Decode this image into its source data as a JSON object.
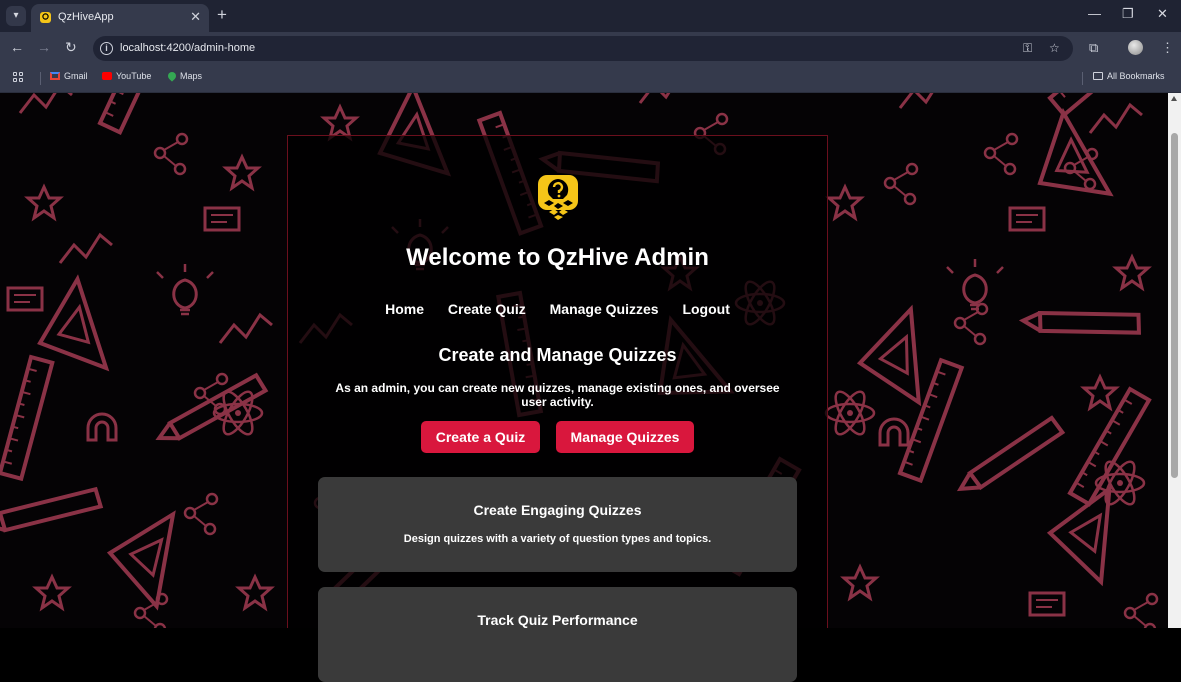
{
  "browser": {
    "tab_title": "QzHiveApp",
    "url": "localhost:4200/admin-home",
    "bookmarks": [
      {
        "label": "Gmail",
        "icon": "gmail-icon",
        "color": "#ea4335"
      },
      {
        "label": "YouTube",
        "icon": "youtube-icon",
        "color": "#ff0000"
      },
      {
        "label": "Maps",
        "icon": "maps-icon",
        "color": "#34a853"
      }
    ],
    "all_bookmarks": "All Bookmarks"
  },
  "page": {
    "welcome_title": "Welcome to QzHive Admin",
    "nav": [
      "Home",
      "Create Quiz",
      "Manage Quizzes",
      "Logout"
    ],
    "section_title": "Create and Manage Quizzes",
    "section_desc": "As an admin, you can create new quizzes, manage existing ones, and oversee user activity.",
    "buttons": {
      "create": "Create a Quiz",
      "manage": "Manage Quizzes"
    },
    "cards": [
      {
        "title": "Create Engaging Quizzes",
        "text": "Design quizzes with a variety of question types and topics."
      },
      {
        "title": "Track Quiz Performance",
        "text": ""
      }
    ]
  },
  "colors": {
    "accent": "#d9173d",
    "logo": "#f5c518",
    "doodle": "#8a3246",
    "panel_border": "#6b0f1d",
    "card": "#3a3a3a"
  }
}
